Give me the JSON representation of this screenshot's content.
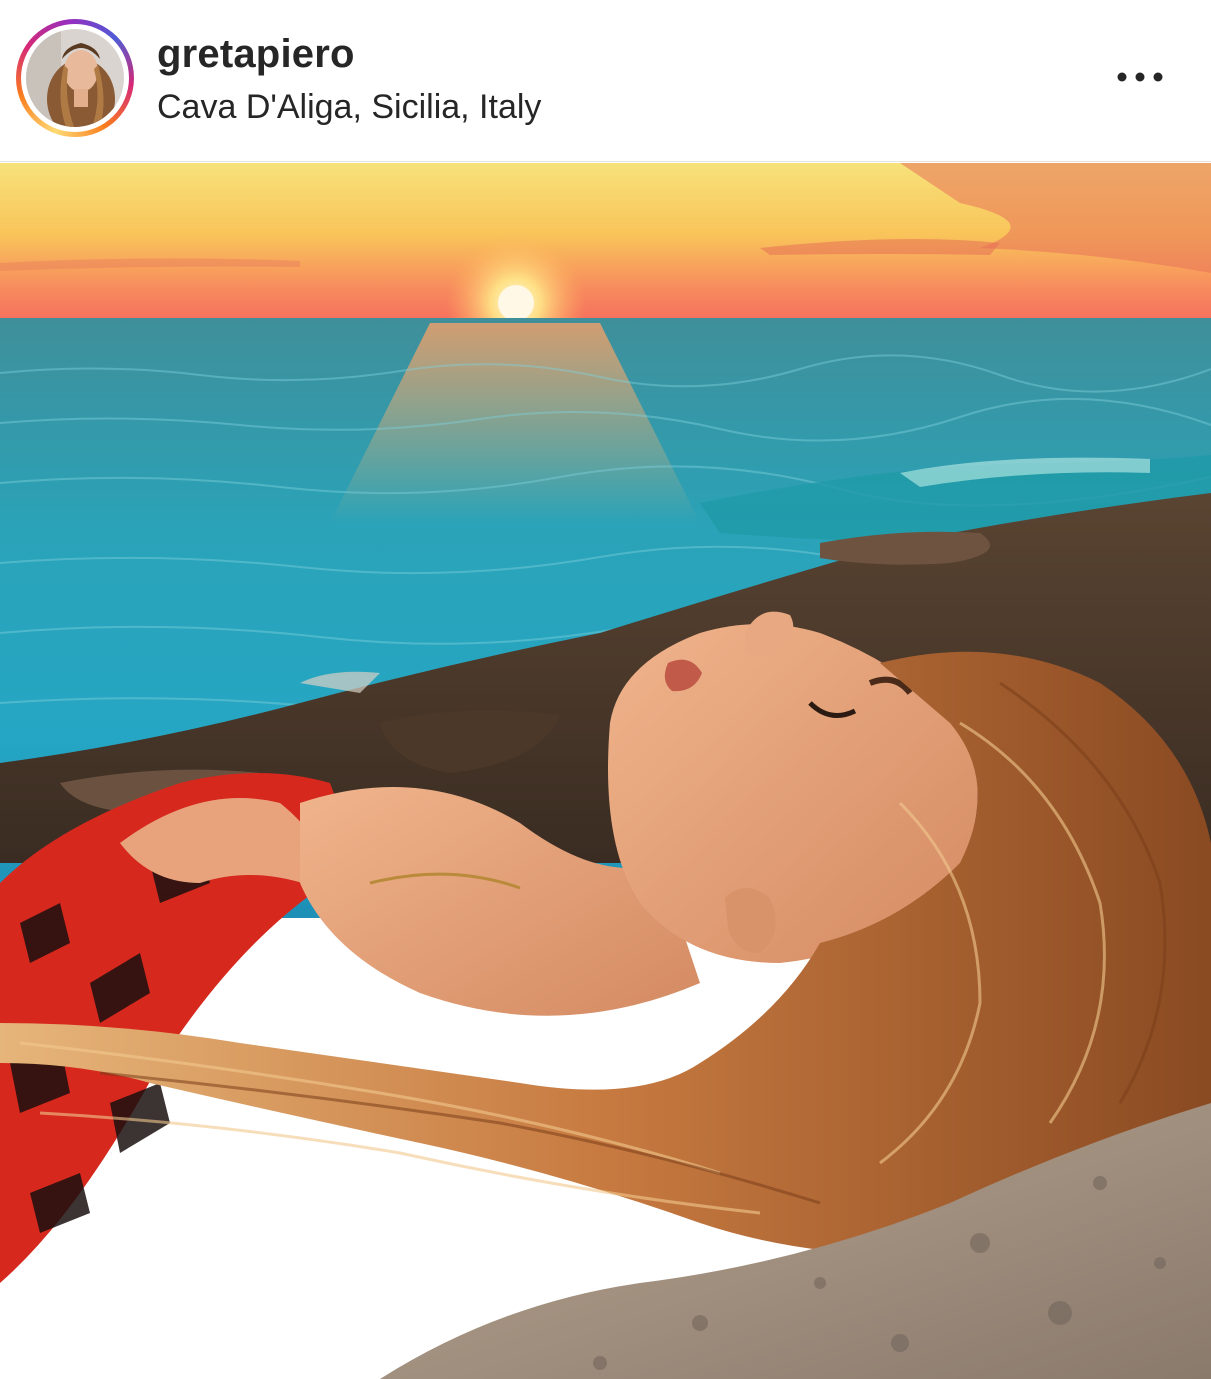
{
  "post": {
    "username": "gretapiero",
    "location": "Cava D'Aliga, Sicilia, Italy",
    "more_icon": "more-horizontal-icon"
  },
  "colors": {
    "text": "#262626",
    "story_ring": [
      "#feda75",
      "#fa7e1e",
      "#d62976",
      "#962fbf",
      "#4f5bd5"
    ]
  }
}
